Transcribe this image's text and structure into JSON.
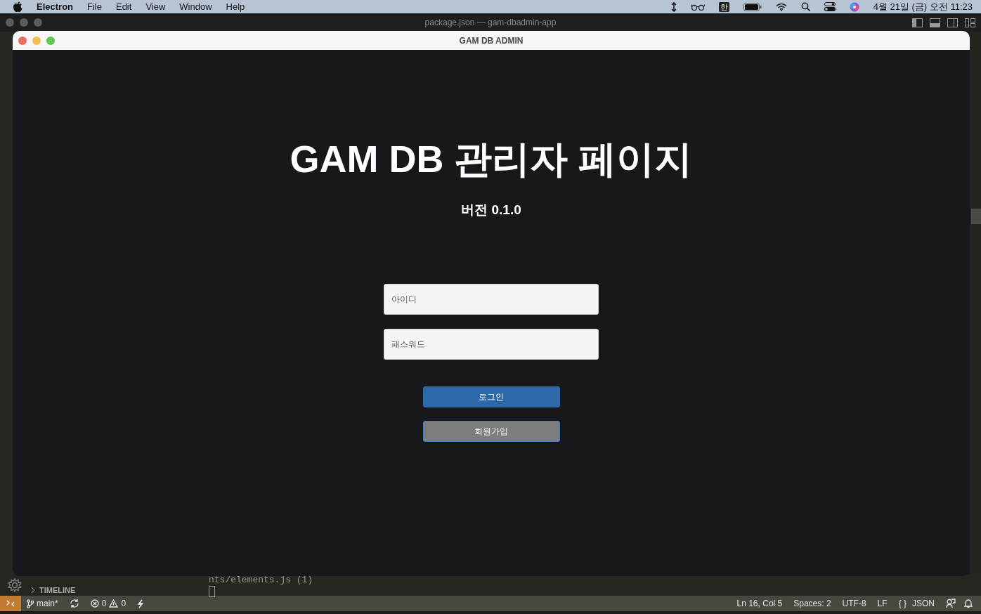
{
  "menu_bar": {
    "app_name": "Electron",
    "menus": [
      "File",
      "Edit",
      "View",
      "Window",
      "Help"
    ],
    "input_indicator": "한",
    "clock": "4월 21일 (금) 오전 11:23"
  },
  "editor_window": {
    "title": "package.json — gam-dbadmin-app",
    "timeline_label": "TIMELINE",
    "terminal_line": "nts/elements.js (1)",
    "status_bar": {
      "branch": "main*",
      "errors": "0",
      "warnings": "0",
      "cursor": "Ln 16, Col 5",
      "indent": "Spaces: 2",
      "encoding": "UTF-8",
      "eol": "LF",
      "language_icon": "{ }",
      "language": "JSON"
    }
  },
  "app_window": {
    "title": "GAM DB ADMIN",
    "heading": "GAM DB 관리자 페이지",
    "version": "버전 0.1.0",
    "fields": [
      {
        "placeholder": "아이디"
      },
      {
        "placeholder": "패스워드"
      }
    ],
    "buttons": [
      {
        "label": "로그인",
        "kind": "primary"
      },
      {
        "label": "회원가입",
        "kind": "secondary"
      }
    ]
  }
}
